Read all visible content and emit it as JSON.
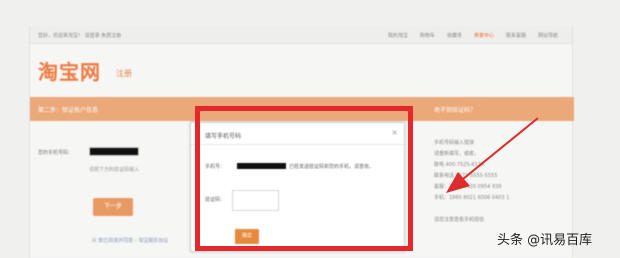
{
  "topbar": {
    "left_text": "您好，欢迎来淘宝！ 请登录 免费注册",
    "nav": [
      "我的淘宝",
      "购物车",
      "收藏夹",
      "卖家中心",
      "联系客服",
      "网站导航"
    ]
  },
  "brand": {
    "logo": "淘宝网",
    "subtitle": "注册"
  },
  "steps": {
    "current": "第二步：验证账户信息",
    "side_title": "收不到验证码？"
  },
  "form": {
    "phone_label": "您的手机号码：",
    "hint": "请把下方的验证码输入",
    "next_button": "下一步",
    "bottom_link": "☒ 我已阅读并同意 › 淘宝服务协议"
  },
  "contact": {
    "lines": [
      "手机号码输入错误",
      "请重新填写，或者，",
      "致电 400-7525-6136",
      "联系电话 0571-5555-5555",
      "客服：1860 2020 0954 939",
      "手机：1860 8021 6006 0403 1",
      "",
      "请您注意查看手机短信"
    ]
  },
  "dialog": {
    "title": "填写手机号码",
    "close": "×",
    "phone_label": "手机号：",
    "sent_text": "已经发送验证码到您的手机，请查收。",
    "code_label": "验证码：",
    "code_value": "",
    "confirm_button": "确定"
  },
  "watermark": "头条 @讯易百库",
  "colors": {
    "highlight_box": "#e3292c",
    "arrow": "#dc2d2a",
    "orange_band": "#eba878",
    "brand_orange": "#f07a40"
  }
}
